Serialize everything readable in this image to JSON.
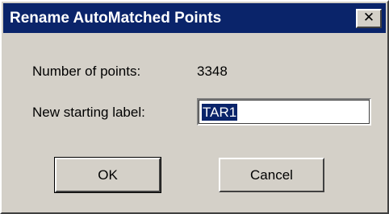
{
  "dialog": {
    "title": "Rename AutoMatched Points",
    "close_glyph": "✕",
    "close_icon": "close-icon"
  },
  "fields": {
    "points_label": "Number of points:",
    "points_value": "3348",
    "label_label": "New starting label:",
    "label_value": "TAR1"
  },
  "buttons": {
    "ok": "OK",
    "cancel": "Cancel"
  },
  "colors": {
    "titlebar": "#0a246a",
    "face": "#d4d0c8",
    "selection": "#0a246a"
  }
}
